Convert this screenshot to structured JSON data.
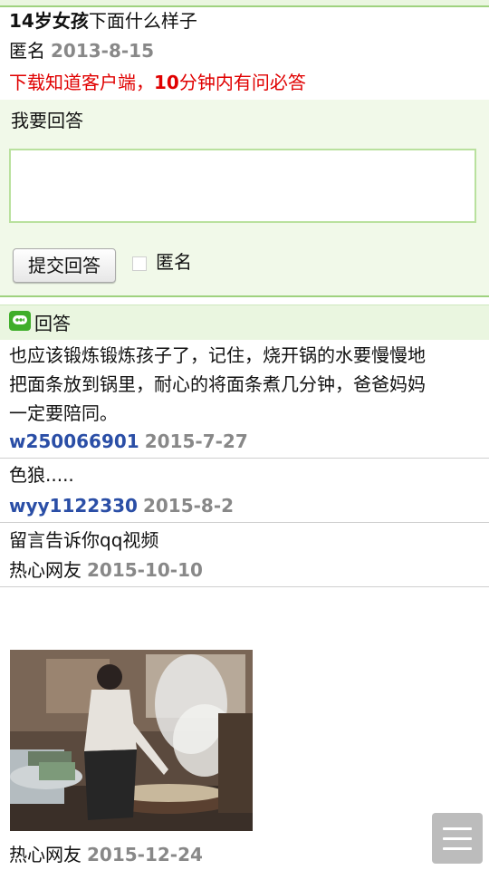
{
  "question": {
    "title_part1": "14岁女孩",
    "title_part2": "下面什么样子",
    "author": "匿名",
    "date": "2013-8-15"
  },
  "promo": {
    "part1": "下载知道客户端，",
    "part2": "10",
    "part3": "分钟内有问必答"
  },
  "answer_form": {
    "label": "我要回答",
    "textarea_value": "",
    "submit_label": "提交回答",
    "anonymous_label": "匿名",
    "anonymous_checked": false
  },
  "answers_header": {
    "icon": "chat-bubble-icon",
    "title": "回答"
  },
  "answers": [
    {
      "line1": "也应该锻炼锻炼孩子了，记住，烧开锅的水要慢慢地",
      "line2": "把面条放到锅里，耐心的将面条煮几分钟，爸爸妈妈",
      "line3": "一定要陪同。",
      "user": "w250066901",
      "date": "2015-7-27"
    },
    {
      "text": "色狼.....",
      "user": "wyy1122330",
      "date": "2015-8-2"
    },
    {
      "text": "留言告诉你qq视频",
      "user": "热心网友",
      "date": "2015-10-10"
    },
    {
      "user": "热心网友",
      "date": "2015-12-24"
    }
  ],
  "menu": {
    "icon": "hamburger-menu-icon"
  },
  "colors": {
    "accent_green": "#9fd27f",
    "panel_bg": "#f1f9e9",
    "promo_red": "#e00000",
    "user_blue": "#2a4ea6",
    "date_gray": "#888888"
  }
}
